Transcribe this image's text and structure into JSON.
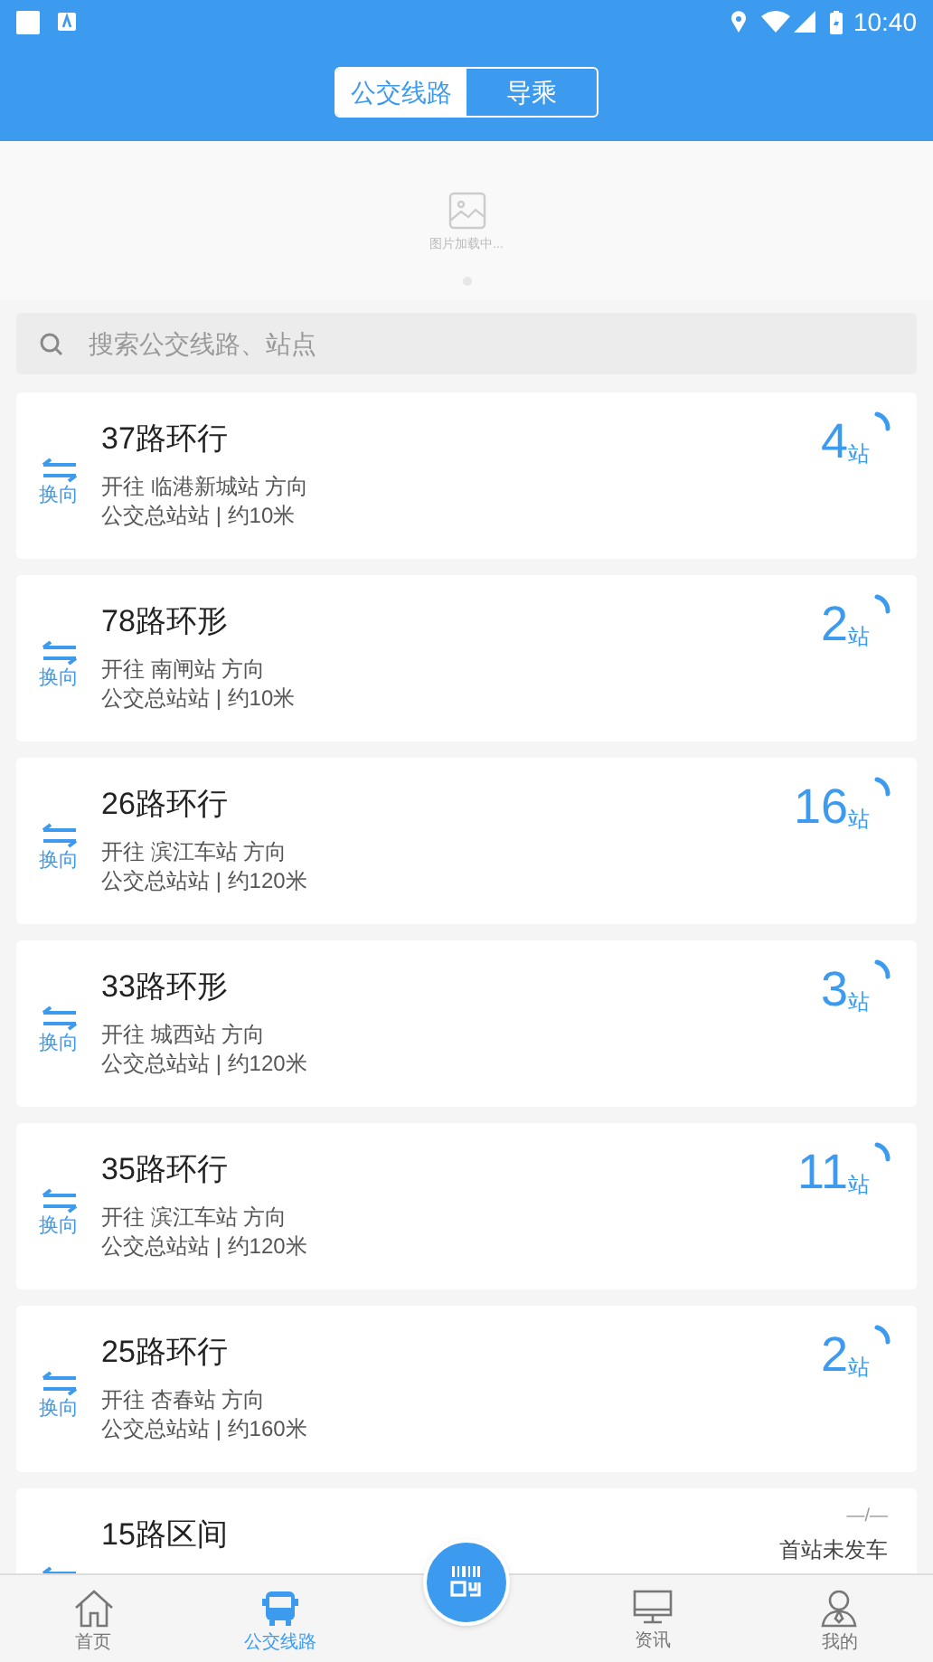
{
  "status_bar": {
    "time": "10:40"
  },
  "tabs": [
    {
      "label": "公交线路",
      "selected": true
    },
    {
      "label": "导乘",
      "selected": false
    }
  ],
  "banner": {
    "loading_text": "图片加载中..."
  },
  "search": {
    "placeholder": "搜索公交线路、站点"
  },
  "routes": [
    {
      "kind": "stops",
      "name": "37路环行",
      "swap_label": "换向",
      "direction": "开往 临港新城站 方向",
      "distance": "公交总站站 | 约10米",
      "count": "4",
      "unit": "站"
    },
    {
      "kind": "stops",
      "name": "78路环形",
      "swap_label": "换向",
      "direction": "开往 南闸站 方向",
      "distance": "公交总站站 | 约10米",
      "count": "2",
      "unit": "站"
    },
    {
      "kind": "stops",
      "name": "26路环行",
      "swap_label": "换向",
      "direction": "开往 滨江车站 方向",
      "distance": "公交总站站 | 约120米",
      "count": "16",
      "unit": "站"
    },
    {
      "kind": "stops",
      "name": "33路环形",
      "swap_label": "换向",
      "direction": "开往 城西站 方向",
      "distance": "公交总站站 | 约120米",
      "count": "3",
      "unit": "站"
    },
    {
      "kind": "stops",
      "name": "35路环行",
      "swap_label": "换向",
      "direction": "开往 滨江车站 方向",
      "distance": "公交总站站 | 约120米",
      "count": "11",
      "unit": "站"
    },
    {
      "kind": "stops",
      "name": "25路环行",
      "swap_label": "换向",
      "direction": "开往 杏春站 方向",
      "distance": "公交总站站 | 约160米",
      "count": "2",
      "unit": "站"
    },
    {
      "kind": "pending",
      "name": "15路区间",
      "dash": "—/—",
      "status": "首站未发车"
    }
  ],
  "bottom_nav": [
    {
      "label": "首页",
      "kind": "home",
      "selected": false
    },
    {
      "label": "公交线路",
      "kind": "bus",
      "selected": true
    },
    {
      "kind": "scan"
    },
    {
      "label": "资讯",
      "kind": "monitor",
      "selected": false
    },
    {
      "label": "我的",
      "kind": "person",
      "selected": false
    }
  ]
}
